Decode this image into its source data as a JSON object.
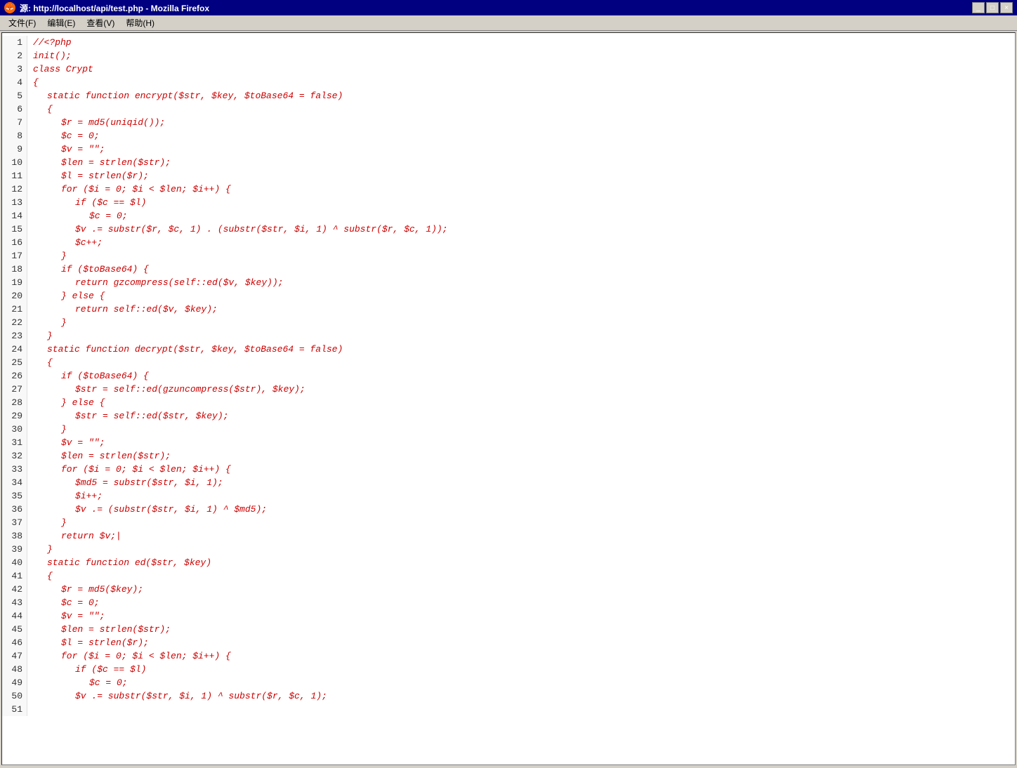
{
  "window": {
    "title": "源: http://localhost/api/test.php - Mozilla Firefox",
    "icon": "🦊"
  },
  "menubar": {
    "items": [
      "文件(F)",
      "编辑(E)",
      "查看(V)",
      "帮助(H)"
    ]
  },
  "code": {
    "lines": [
      {
        "num": 1,
        "indent": 0,
        "text": "//<?php"
      },
      {
        "num": 2,
        "indent": 0,
        "text": "init();"
      },
      {
        "num": 3,
        "indent": 0,
        "text": "class Crypt"
      },
      {
        "num": 4,
        "indent": 0,
        "text": "{"
      },
      {
        "num": 5,
        "indent": 1,
        "text": "static function encrypt($str, $key, $toBase64 = false)"
      },
      {
        "num": 6,
        "indent": 1,
        "text": "{"
      },
      {
        "num": 7,
        "indent": 2,
        "text": "$r = md5(uniqid());"
      },
      {
        "num": 8,
        "indent": 2,
        "text": "$c = 0;"
      },
      {
        "num": 9,
        "indent": 2,
        "text": "$v = \"\";"
      },
      {
        "num": 10,
        "indent": 2,
        "text": "$len = strlen($str);"
      },
      {
        "num": 11,
        "indent": 2,
        "text": "$l = strlen($r);"
      },
      {
        "num": 12,
        "indent": 2,
        "text": "for ($i = 0; $i < $len; $i++) {"
      },
      {
        "num": 13,
        "indent": 3,
        "text": "if ($c == $l)"
      },
      {
        "num": 14,
        "indent": 4,
        "text": "$c = 0;"
      },
      {
        "num": 15,
        "indent": 3,
        "text": "$v .= substr($r, $c, 1) . (substr($str, $i, 1) ^ substr($r, $c, 1));"
      },
      {
        "num": 16,
        "indent": 3,
        "text": "$c++;"
      },
      {
        "num": 17,
        "indent": 2,
        "text": "}"
      },
      {
        "num": 18,
        "indent": 2,
        "text": "if ($toBase64) {"
      },
      {
        "num": 19,
        "indent": 3,
        "text": "return gzcompress(self::ed($v, $key));"
      },
      {
        "num": 20,
        "indent": 2,
        "text": "} else {"
      },
      {
        "num": 21,
        "indent": 3,
        "text": "return self::ed($v, $key);"
      },
      {
        "num": 22,
        "indent": 2,
        "text": "}"
      },
      {
        "num": 23,
        "indent": 0,
        "text": ""
      },
      {
        "num": 24,
        "indent": 1,
        "text": "}"
      },
      {
        "num": 25,
        "indent": 1,
        "text": "static function decrypt($str, $key, $toBase64 = false)"
      },
      {
        "num": 26,
        "indent": 1,
        "text": "{"
      },
      {
        "num": 27,
        "indent": 2,
        "text": "if ($toBase64) {"
      },
      {
        "num": 28,
        "indent": 3,
        "text": "$str = self::ed(gzuncompress($str), $key);"
      },
      {
        "num": 29,
        "indent": 2,
        "text": "} else {"
      },
      {
        "num": 30,
        "indent": 3,
        "text": "$str = self::ed($str, $key);"
      },
      {
        "num": 31,
        "indent": 2,
        "text": "}"
      },
      {
        "num": 32,
        "indent": 2,
        "text": "$v = \"\";"
      },
      {
        "num": 33,
        "indent": 2,
        "text": "$len = strlen($str);"
      },
      {
        "num": 34,
        "indent": 2,
        "text": "for ($i = 0; $i < $len; $i++) {"
      },
      {
        "num": 35,
        "indent": 3,
        "text": "$md5 = substr($str, $i, 1);"
      },
      {
        "num": 36,
        "indent": 3,
        "text": "$i++;"
      },
      {
        "num": 37,
        "indent": 3,
        "text": "$v .= (substr($str, $i, 1) ^ $md5);"
      },
      {
        "num": 38,
        "indent": 2,
        "text": "}"
      },
      {
        "num": 39,
        "indent": 2,
        "text": "return $v;|"
      },
      {
        "num": 40,
        "indent": 1,
        "text": "}"
      },
      {
        "num": 41,
        "indent": 1,
        "text": "static function ed($str, $key)"
      },
      {
        "num": 42,
        "indent": 1,
        "text": "{"
      },
      {
        "num": 43,
        "indent": 2,
        "text": "$r = md5($key);"
      },
      {
        "num": 44,
        "indent": 2,
        "text": "$c = 0;"
      },
      {
        "num": 45,
        "indent": 2,
        "text": "$v = \"\";"
      },
      {
        "num": 46,
        "indent": 2,
        "text": "$len = strlen($str);"
      },
      {
        "num": 47,
        "indent": 2,
        "text": "$l = strlen($r);"
      },
      {
        "num": 48,
        "indent": 2,
        "text": "for ($i = 0; $i < $len; $i++) {"
      },
      {
        "num": 49,
        "indent": 3,
        "text": "if ($c == $l)"
      },
      {
        "num": 50,
        "indent": 4,
        "text": "$c = 0;"
      },
      {
        "num": 51,
        "indent": 3,
        "text": "$v .= substr($str, $i, 1) ^ substr($r, $c, 1);"
      }
    ]
  }
}
